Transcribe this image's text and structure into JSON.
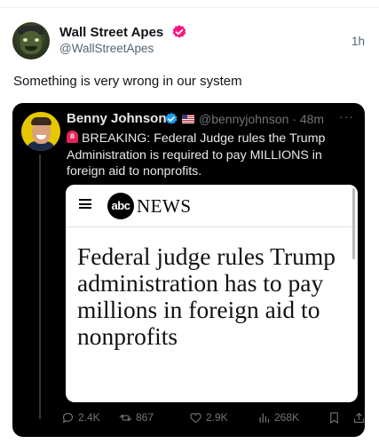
{
  "tweet": {
    "author": {
      "display_name": "Wall Street Apes",
      "handle": "@WallStreetApes",
      "verified_icon": "verified-badge-icon",
      "verified_color": "#f91880"
    },
    "timestamp": "1h",
    "text": "Something is very wrong in our system"
  },
  "quoted": {
    "author": {
      "display_name": "Benny Johnson",
      "handle_time": "@bennyjohnson · 48m",
      "verified_color": "#1d9bf0",
      "flag_icon": "us-flag-icon"
    },
    "more_label": "···",
    "text": "BREAKING: Federal Judge rules the Trump Administration is required to pay MILLIONS in foreign aid to nonprofits.",
    "article": {
      "logo_text": "abc",
      "brand_word": "NEWS",
      "headline": "Federal judge rules Trump administration has to pay millions in foreign aid to nonprofits"
    },
    "actions": {
      "replies": "2.4K",
      "reposts": "867",
      "likes": "2.9K",
      "views": "268K"
    }
  },
  "colors": {
    "quote_bg": "#000000",
    "muted_text": "#71767b",
    "primary_text": "#0f1419"
  }
}
